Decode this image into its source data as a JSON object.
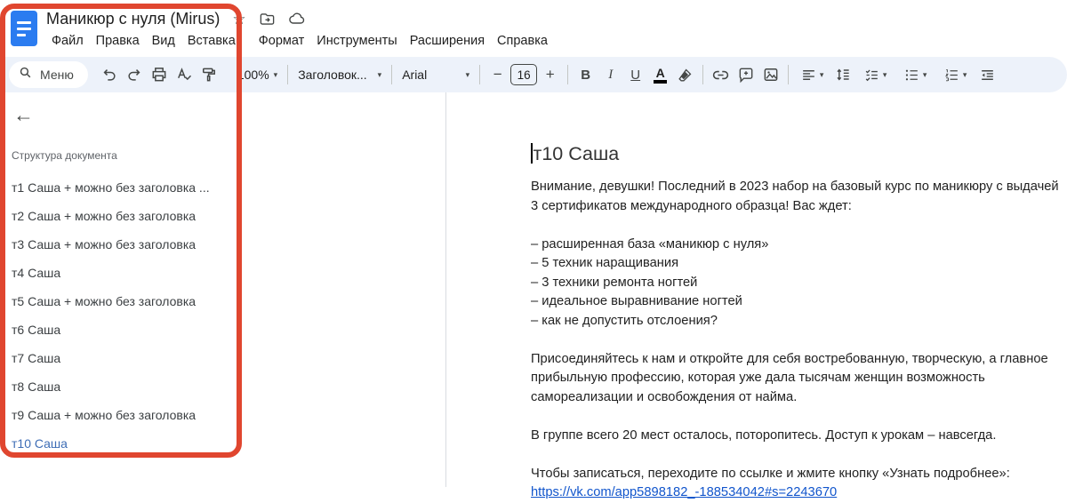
{
  "header": {
    "doc_title": "Маникюр с нуля (Mirus)",
    "menu_items": [
      "Файл",
      "Правка",
      "Вид",
      "Вставка",
      "Формат",
      "Инструменты",
      "Расширения",
      "Справка"
    ]
  },
  "toolbar": {
    "search_label": "Меню",
    "zoom_value": "100%",
    "style_value": "Заголовок...",
    "font_value": "Arial",
    "font_size": "16",
    "bold_label": "B",
    "italic_label": "I",
    "underline_label": "U",
    "text_color_label": "A"
  },
  "icons": {
    "caret_down": "▾",
    "back_arrow": "←",
    "star": "☆",
    "minus": "−",
    "plus": "+"
  },
  "outline": {
    "title": "Структура документа",
    "items": [
      "т1 Саша + можно без заголовка ...",
      "т2 Саша + можно без заголовка",
      "т3 Саша + можно без заголовка",
      "т4 Саша",
      "т5 Саша + можно без заголовка",
      "т6 Саша",
      "т7 Саша",
      "т8 Саша",
      "т9 Саша + можно без заголовка",
      "т10 Саша"
    ],
    "active_item": "т10 Саша"
  },
  "document": {
    "heading": "т10 Саша",
    "paragraphs": [
      "Внимание, девушки! Последний в 2023 набор на базовый курс по маникюру с выдачей 3 сертификатов международного образца! Вас ждет:",
      "",
      "– расширенная база «маникюр с нуля»",
      "– 5 техник наращивания",
      "– 3 техники ремонта ногтей",
      "– идеальное выравнивание ногтей",
      "– как не допустить отслоения?",
      "",
      "Присоединяйтесь к нам и откройте для себя востребованную, творческую, а главное прибыльную профессию, которая уже дала тысячам женщин возможность самореализации и освобождения от найма.",
      "",
      "В группе всего 20 мест осталось, поторопитесь. Доступ к урокам – навсегда.",
      "",
      "Чтобы записаться, переходите по ссылке и жмите кнопку «Узнать подробнее»:"
    ],
    "link_text": "https://vk.com/app5898182_-188534042#s=2243670"
  },
  "colors": {
    "annotation_red": "#e0462f",
    "toolbar_bg": "#edf2fa",
    "active_outline_blue": "#3e6db5",
    "link_blue": "#1155cc",
    "docs_logo_blue": "#2b7cf0",
    "icon_gray": "#444746"
  }
}
